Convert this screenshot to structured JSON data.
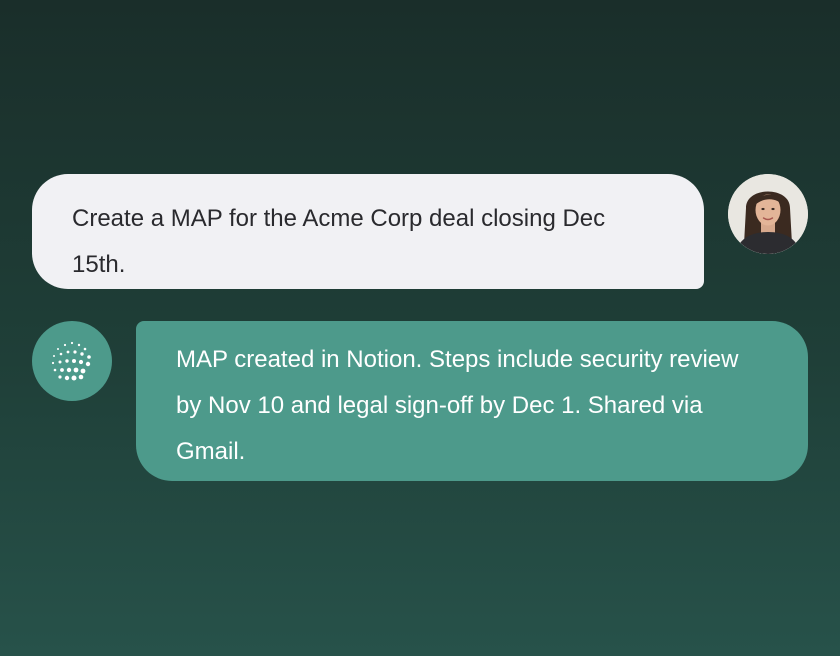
{
  "conversation": {
    "messages": [
      {
        "role": "user",
        "text": "Create a MAP for the Acme Corp deal closing Dec 15th.",
        "avatar_icon": "user-avatar-photo"
      },
      {
        "role": "assistant",
        "text": "MAP created in Notion. Steps include security review by Nov 10 and legal sign-off by Dec 1. Shared via Gmail.",
        "avatar_icon": "dot-sphere-logo-icon"
      }
    ]
  },
  "colors": {
    "background_top": "#1a2e2a",
    "background_bottom": "#27524a",
    "user_bubble": "#f1f1f4",
    "user_text": "#2a2a2e",
    "assistant_bubble": "#4d9a8b",
    "assistant_text": "#ffffff"
  }
}
